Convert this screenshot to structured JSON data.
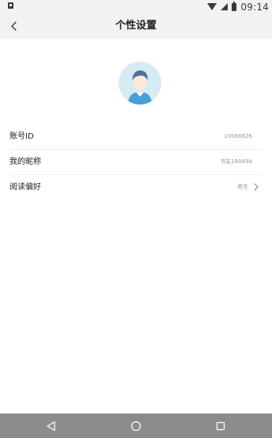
{
  "status_bar": {
    "time": "09:14",
    "icons": [
      "notification-icon",
      "wifi-icon",
      "signal-icon",
      "battery-icon"
    ]
  },
  "header": {
    "title": "个性设置",
    "back_icon": "chevron-left-icon"
  },
  "avatar": {
    "icon": "default-user-avatar"
  },
  "settings": [
    {
      "label": "账号ID",
      "value": "10066826"
    },
    {
      "label": "我的昵称",
      "value": "书友180494"
    },
    {
      "label": "阅读偏好",
      "value": "男生",
      "icon": "chevron-right-icon"
    }
  ],
  "system_nav": {
    "icons": [
      "triangle-back-icon",
      "circle-home-icon",
      "square-recents-icon"
    ]
  },
  "colors": {
    "header_bg": "#f2f2f2",
    "avatar_bg": "#d6ecf5",
    "system_nav_bg": "#8c8c8c"
  }
}
